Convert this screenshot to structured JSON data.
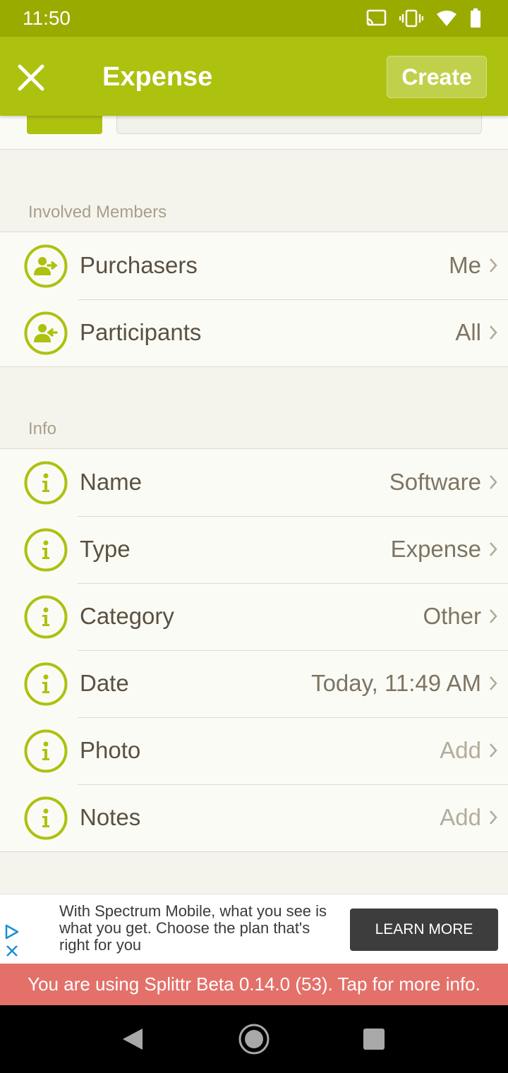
{
  "status_bar": {
    "time": "11:50"
  },
  "app_bar": {
    "title": "Expense",
    "create_label": "Create"
  },
  "sections": {
    "involved": {
      "header": "Involved Members",
      "rows": [
        {
          "label": "Purchasers",
          "value": "Me",
          "icon": "person-out-icon"
        },
        {
          "label": "Participants",
          "value": "All",
          "icon": "person-in-icon"
        }
      ]
    },
    "info": {
      "header": "Info",
      "rows": [
        {
          "label": "Name",
          "value": "Software",
          "icon": "info-icon"
        },
        {
          "label": "Type",
          "value": "Expense",
          "icon": "info-icon"
        },
        {
          "label": "Category",
          "value": "Other",
          "icon": "info-icon"
        },
        {
          "label": "Date",
          "value": "Today, 11:49 AM",
          "icon": "info-icon"
        },
        {
          "label": "Photo",
          "value": "Add",
          "icon": "info-icon"
        },
        {
          "label": "Notes",
          "value": "Add",
          "icon": "info-icon"
        }
      ]
    }
  },
  "ad": {
    "text": "With Spectrum Mobile, what you see is what you get. Choose the plan that's right for you",
    "cta": "LEARN MORE"
  },
  "beta_banner": "You are using Splittr Beta 0.14.0 (53). Tap for more info.",
  "colors": {
    "accent": "#adc10f",
    "status_bar": "#9aab00",
    "beta_banner": "#e3716a"
  }
}
